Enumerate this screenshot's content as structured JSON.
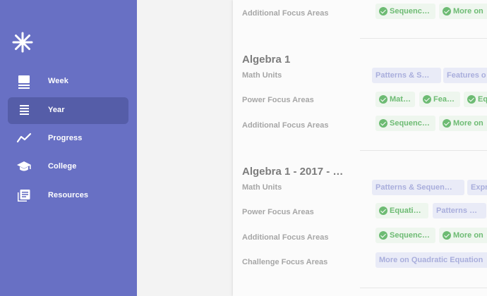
{
  "sidebar": {
    "items": [
      {
        "label": "Week",
        "icon": "week-icon"
      },
      {
        "label": "Year",
        "icon": "year-list-icon"
      },
      {
        "label": "Progress",
        "icon": "progress-chart-icon"
      },
      {
        "label": "College",
        "icon": "graduation-cap-icon"
      },
      {
        "label": "Resources",
        "icon": "library-books-icon"
      }
    ],
    "active": "Year",
    "colors": {
      "background": "#6870c4",
      "active": "#555da8"
    }
  },
  "course0": {
    "row_additional": "Additional Focus Areas",
    "chips_additional": [
      "Sequenc…",
      "More on"
    ]
  },
  "course1": {
    "title": "Algebra 1",
    "row_units": "Math Units",
    "row_power": "Power Focus Areas",
    "row_additional": "Additional Focus Areas",
    "chips_units": [
      "Patterns & S…",
      "Features o"
    ],
    "chips_power": [
      "Mat…",
      "Fea…",
      "Eq"
    ],
    "chips_additional": [
      "Sequenc…",
      "More on"
    ]
  },
  "course2": {
    "title": "Algebra 1 - 2017 - …",
    "row_units": "Math Units",
    "row_power": "Power Focus Areas",
    "row_additional": "Additional Focus Areas",
    "row_challenge": "Challenge Focus Areas",
    "chips_units": [
      "Patterns & Sequen…",
      "Expr"
    ],
    "chips_power": [
      "Equati…",
      "Patterns …"
    ],
    "chips_additional": [
      "Sequenc…",
      "More on"
    ],
    "chips_challenge": [
      "More on Quadratic Equation"
    ]
  },
  "colors": {
    "completed": "#6dbb73",
    "unit_chip": "#a9aedc"
  }
}
